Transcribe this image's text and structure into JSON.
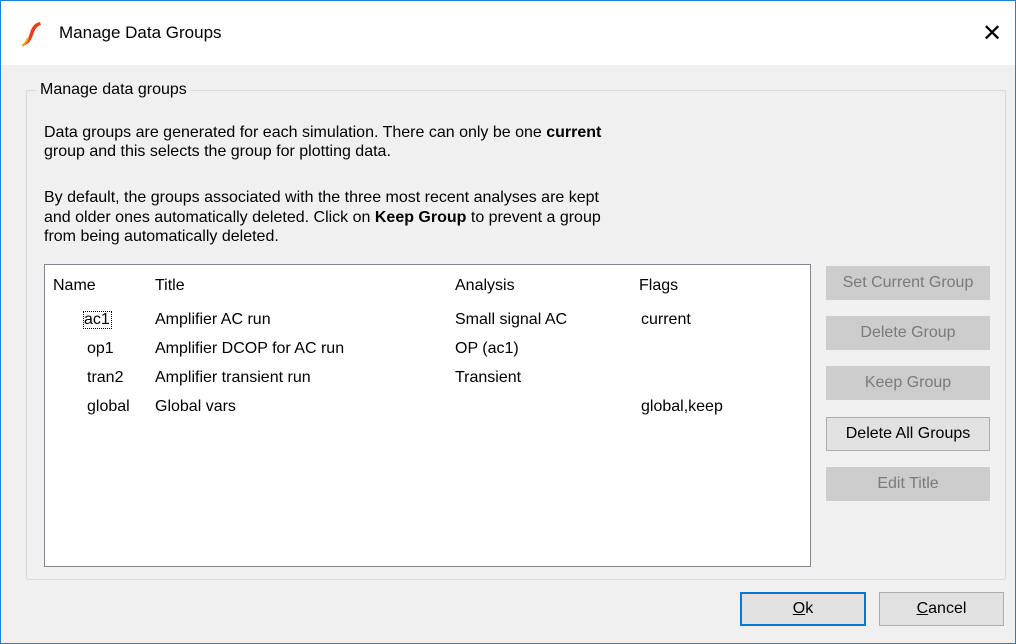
{
  "window": {
    "title": "Manage Data Groups",
    "close_glyph": "✕"
  },
  "groupbox": {
    "label": "Manage data groups"
  },
  "description": {
    "p1_line1_a": "Data groups are generated for each simulation. There can only be one ",
    "p1_line1_bold": "current",
    "p1_line2": "group and this selects the group for plotting data.",
    "p2_line1": "By default, the groups associated with the three most recent analyses are kept",
    "p2_line2_a": "and older ones automatically deleted. Click on ",
    "p2_line2_bold": "Keep Group",
    "p2_line2_b": " to prevent a group",
    "p2_line3": "from being automatically deleted."
  },
  "table": {
    "columns": [
      "Name",
      "Title",
      "Analysis",
      "Flags"
    ],
    "rows": [
      {
        "name": "ac1",
        "title": "Amplifier AC run",
        "analysis": "Small signal AC",
        "flags": "current"
      },
      {
        "name": "op1",
        "title": "Amplifier DCOP for AC run",
        "analysis": "OP (ac1)",
        "flags": ""
      },
      {
        "name": "tran2",
        "title": "Amplifier transient run",
        "analysis": "Transient",
        "flags": ""
      },
      {
        "name": "global",
        "title": "Global vars",
        "analysis": "",
        "flags": "global,keep"
      }
    ]
  },
  "buttons": {
    "set_current": "Set Current Group",
    "delete_group": "Delete Group",
    "keep_group": "Keep Group",
    "delete_all": "Delete All Groups",
    "edit_title": "Edit Title",
    "ok_mnemonic": "O",
    "ok_rest": "k",
    "cancel_mnemonic": "C",
    "cancel_rest": "ancel"
  },
  "colors": {
    "accent": "#0078d7",
    "window_border": "#1883d7",
    "disabled_text": "#7a7a7a"
  },
  "icons": {
    "app": "simetrix-logo-icon",
    "close": "close-icon"
  }
}
